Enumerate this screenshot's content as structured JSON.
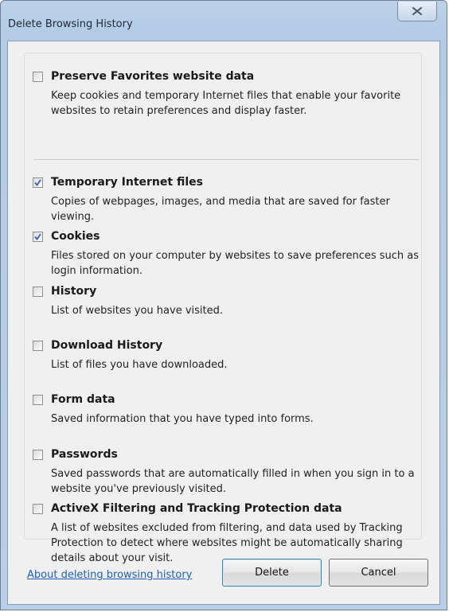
{
  "window": {
    "title": "Delete Browsing History",
    "close_icon": "close-x-icon"
  },
  "options": [
    {
      "label": "Preserve Favorites website data",
      "checked": false,
      "description": "Keep cookies and temporary Internet files that enable your favorite websites to retain preferences and display faster."
    },
    {
      "label": "Temporary Internet files",
      "checked": true,
      "description": "Copies of webpages, images, and media that are saved for faster viewing."
    },
    {
      "label": "Cookies",
      "checked": true,
      "description": "Files stored on your computer by websites to save preferences such as login information."
    },
    {
      "label": "History",
      "checked": false,
      "description": "List of websites you have visited."
    },
    {
      "label": "Download History",
      "checked": false,
      "description": "List of files you have downloaded."
    },
    {
      "label": "Form data",
      "checked": false,
      "description": "Saved information that you have typed into forms."
    },
    {
      "label": "Passwords",
      "checked": false,
      "description": "Saved passwords that are automatically filled in when you sign in to a website you've previously visited."
    },
    {
      "label": "ActiveX Filtering and Tracking Protection data",
      "checked": false,
      "description": "A list of websites excluded from filtering, and data used by Tracking Protection to detect where websites might be automatically sharing details about your visit."
    }
  ],
  "footer": {
    "about_link": "About deleting browsing history",
    "delete_label": "Delete",
    "cancel_label": "Cancel"
  }
}
